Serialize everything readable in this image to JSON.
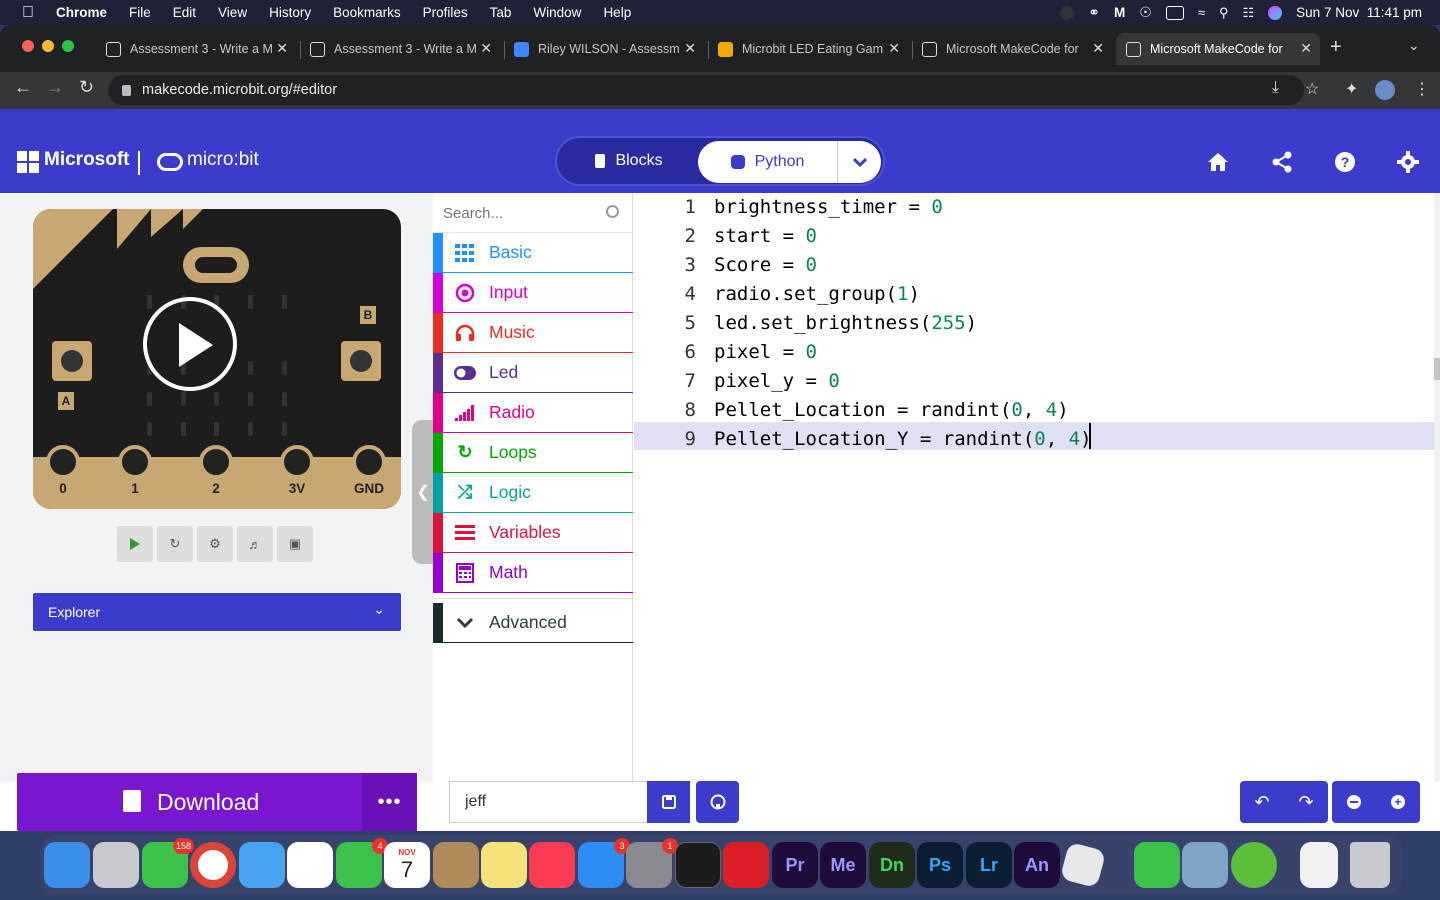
{
  "menubar": {
    "app": "Chrome",
    "menus": [
      "File",
      "Edit",
      "View",
      "History",
      "Bookmarks",
      "Profiles",
      "Tab",
      "Window",
      "Help"
    ],
    "datetime": "Sun 7 Nov  11:41 pm"
  },
  "tabs": [
    {
      "title": "Assessment 3 - Write a M"
    },
    {
      "title": "Assessment 3 - Write a M"
    },
    {
      "title": "Riley WILSON - Assessme"
    },
    {
      "title": "Microbit LED Eating Gam"
    },
    {
      "title": "Microsoft MakeCode for"
    },
    {
      "title": "Microsoft MakeCode for"
    }
  ],
  "address": "makecode.microbit.org/#editor",
  "header": {
    "brand": "Microsoft",
    "product": "micro:bit",
    "mode_blocks": "Blocks",
    "mode_python": "Python"
  },
  "simulator": {
    "pins": [
      "0",
      "1",
      "2",
      "3V",
      "GND"
    ],
    "button_a": "A",
    "button_b": "B",
    "explorer": "Explorer"
  },
  "toolbox": {
    "search_placeholder": "Search...",
    "categories": [
      {
        "label": "Basic",
        "color": "#1e90ff"
      },
      {
        "label": "Input",
        "color": "#d400d4"
      },
      {
        "label": "Music",
        "color": "#e63022"
      },
      {
        "label": "Led",
        "color": "#5c2d91"
      },
      {
        "label": "Radio",
        "color": "#e3008c"
      },
      {
        "label": "Loops",
        "color": "#00aa00"
      },
      {
        "label": "Logic",
        "color": "#00a4a6"
      },
      {
        "label": "Variables",
        "color": "#dc143c"
      },
      {
        "label": "Math",
        "color": "#9400d3"
      }
    ],
    "advanced": "Advanced"
  },
  "editor": {
    "lines": [
      {
        "n": "1",
        "pre": "brightness_timer = ",
        "num": "0",
        "post": ""
      },
      {
        "n": "2",
        "pre": "start = ",
        "num": "0",
        "post": ""
      },
      {
        "n": "3",
        "pre": "Score = ",
        "num": "0",
        "post": ""
      },
      {
        "n": "4",
        "pre": "radio.set_group(",
        "num": "1",
        "post": ")"
      },
      {
        "n": "5",
        "pre": "led.set_brightness(",
        "num": "255",
        "post": ")"
      },
      {
        "n": "6",
        "pre": "pixel = ",
        "num": "0",
        "post": ""
      },
      {
        "n": "7",
        "pre": "pixel_y = ",
        "num": "0",
        "post": ""
      },
      {
        "n": "8",
        "pre": "Pellet_Location = randint(",
        "num": "0",
        "mid": ", ",
        "num2": "4",
        "post": ")"
      },
      {
        "n": "9",
        "pre": "Pellet_Location_Y = randint(",
        "num": "0",
        "mid": ", ",
        "num2": "4",
        "post": ")"
      }
    ]
  },
  "footer": {
    "download": "Download",
    "more": "•••",
    "project_name": "jeff"
  },
  "dock": {
    "badges": {
      "messages": "158",
      "facetime": "4",
      "calendar_day": "7",
      "calendar_month": "NOV",
      "appstore": "3",
      "settings": "1"
    },
    "apps": [
      "Pr",
      "Me",
      "Dn",
      "Ps",
      "Lr",
      "An"
    ]
  }
}
